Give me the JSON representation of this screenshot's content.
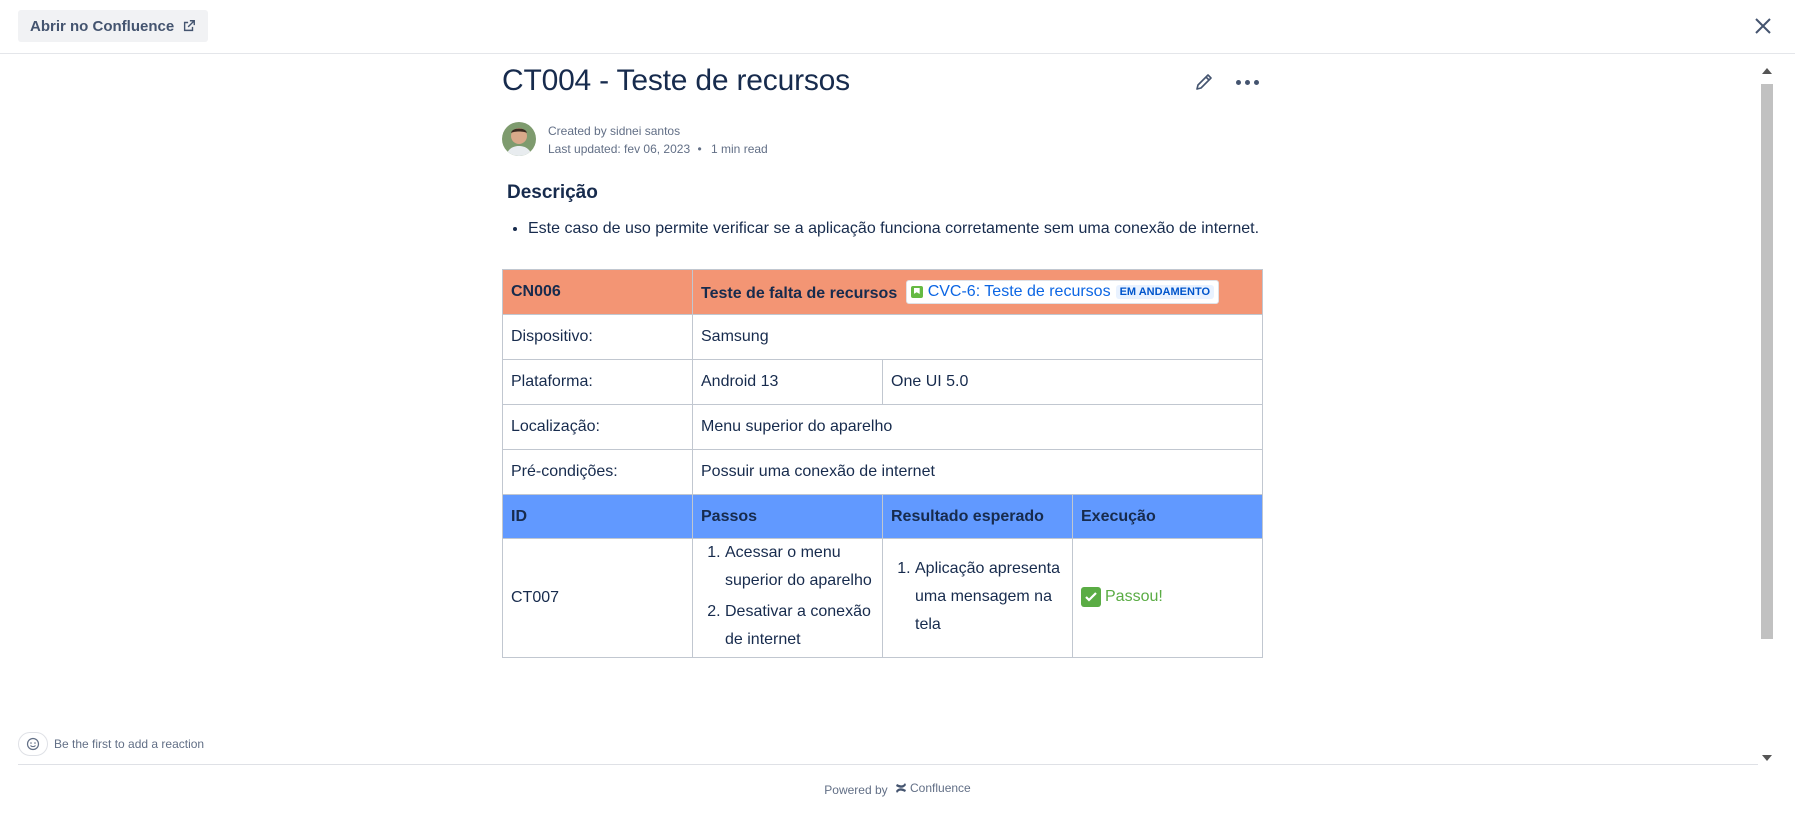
{
  "topbar": {
    "open_label": "Abrir no Confluence",
    "open_icon": "external-link-icon",
    "close_icon": "close-icon"
  },
  "page": {
    "title": "CT004 - Teste de recursos",
    "created_by": "Created by sidnei santos",
    "last_updated": "Last updated: fev 06, 2023",
    "read_time": "1 min read",
    "separator": "•"
  },
  "description": {
    "heading": "Descrição",
    "items": [
      "Este caso de uso permite verificar se a aplicação funciona corretamente sem uma conexão de internet."
    ]
  },
  "table": {
    "header": {
      "id": "CN006",
      "title": "Teste de falta de recursos",
      "jira_key": "CVC-6: Teste de recursos",
      "jira_status": "EM ANDAMENTO"
    },
    "rows": [
      {
        "label": "Dispositivo:",
        "value": "Samsung"
      },
      {
        "label": "Plataforma:",
        "value": "Android 13",
        "value2": "One UI 5.0"
      },
      {
        "label": "Localização:",
        "value": "Menu superior do aparelho"
      },
      {
        "label": "Pré-condições:",
        "value": "Possuir uma conexão de internet"
      }
    ],
    "columns": [
      "ID",
      "Passos",
      "Resultado esperado",
      "Execução"
    ],
    "step_row": {
      "id": "CT007",
      "steps": [
        "Acessar o menu superior do aparelho",
        "Desativar a conexão de internet"
      ],
      "expected": [
        "Aplicação apresenta uma mensagem na tela"
      ],
      "execution": "Passou!"
    }
  },
  "reactions": {
    "label": "Be the first to add a reaction"
  },
  "footer": {
    "powered_by": "Powered by",
    "brand": "Confluence"
  },
  "colors": {
    "header_row": "#f39574",
    "column_row": "#6199ff",
    "pass": "#5aac44",
    "link": "#0c66e4"
  }
}
